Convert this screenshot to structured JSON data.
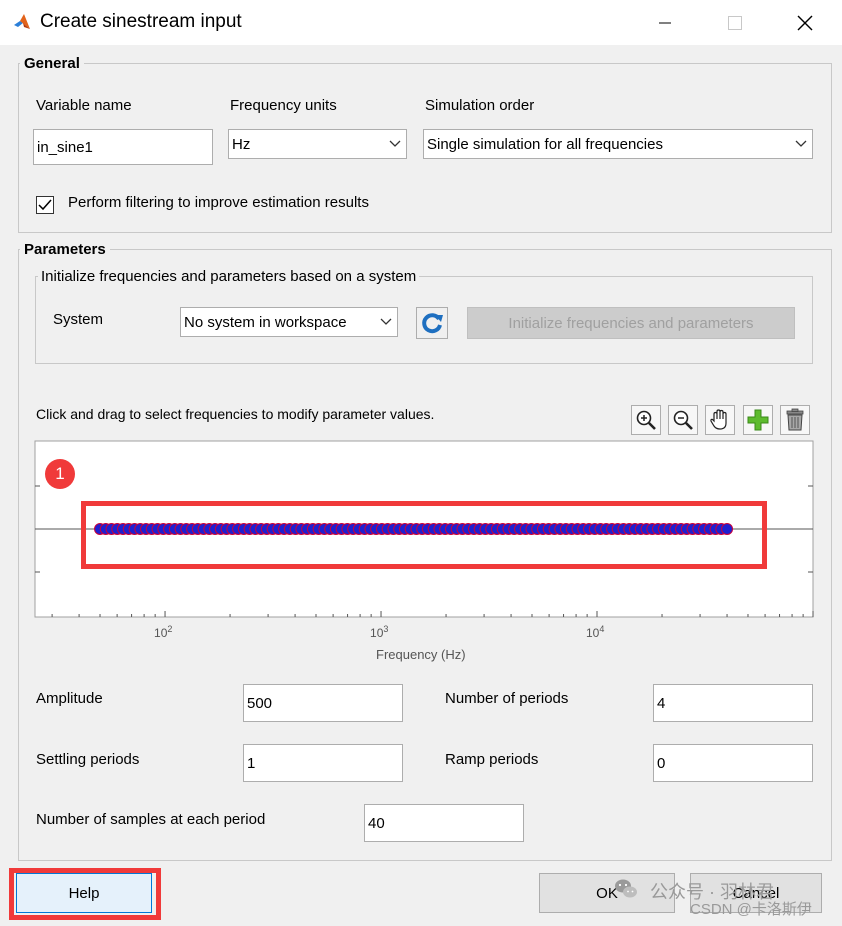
{
  "window": {
    "title": "Create sinestream input",
    "minimize_icon": "minimize-icon",
    "maximize_icon": "maximize-icon",
    "close_icon": "close-icon"
  },
  "general": {
    "group_label": "General",
    "variable_name_label": "Variable name",
    "variable_name_value": "in_sine1",
    "frequency_units_label": "Frequency units",
    "frequency_units_value": "Hz",
    "simulation_order_label": "Simulation order",
    "simulation_order_value": "Single simulation for all frequencies",
    "filtering_label": "Perform filtering to improve estimation results",
    "filtering_checked": true
  },
  "parameters": {
    "group_label": "Parameters",
    "init_group_label": "Initialize frequencies and parameters based on a system",
    "system_label": "System",
    "system_value": "No system in workspace",
    "refresh_icon": "refresh-icon",
    "init_button_label": "Initialize frequencies and parameters",
    "plot_hint": "Click and drag to select frequencies to modify parameter values.",
    "tools": [
      "zoom-in-icon",
      "zoom-out-icon",
      "pan-hand-icon",
      "add-plus-icon",
      "trash-icon"
    ],
    "amplitude_label": "Amplitude",
    "amplitude_value": "500",
    "num_periods_label": "Number of periods",
    "num_periods_value": "4",
    "settling_label": "Settling periods",
    "settling_value": "1",
    "ramp_label": "Ramp periods",
    "ramp_value": "0",
    "samples_label": "Number of samples at each period",
    "samples_value": "40"
  },
  "chart_data": {
    "type": "scatter",
    "xscale": "log",
    "xlabel": "Frequency (Hz)",
    "xticks": [
      {
        "base": "10",
        "exp": "2",
        "value": 100
      },
      {
        "base": "10",
        "exp": "3",
        "value": 1000
      },
      {
        "base": "10",
        "exp": "4",
        "value": 10000
      }
    ],
    "xlim": [
      25,
      100000
    ],
    "x_start": 50,
    "x_end": 40000,
    "point_count": 110,
    "y_value": 0,
    "marker_color": "#1f1fcf",
    "marker_edge": "#c8003c"
  },
  "annotation": {
    "badge_text": "1",
    "frame_color": "#f03a3a"
  },
  "footer": {
    "help_label": "Help",
    "ok_label": "OK",
    "cancel_label": "Cancel"
  },
  "watermark": {
    "line1": "公众号 · 羽林君",
    "line2": "CSDN @卡洛斯伊"
  }
}
